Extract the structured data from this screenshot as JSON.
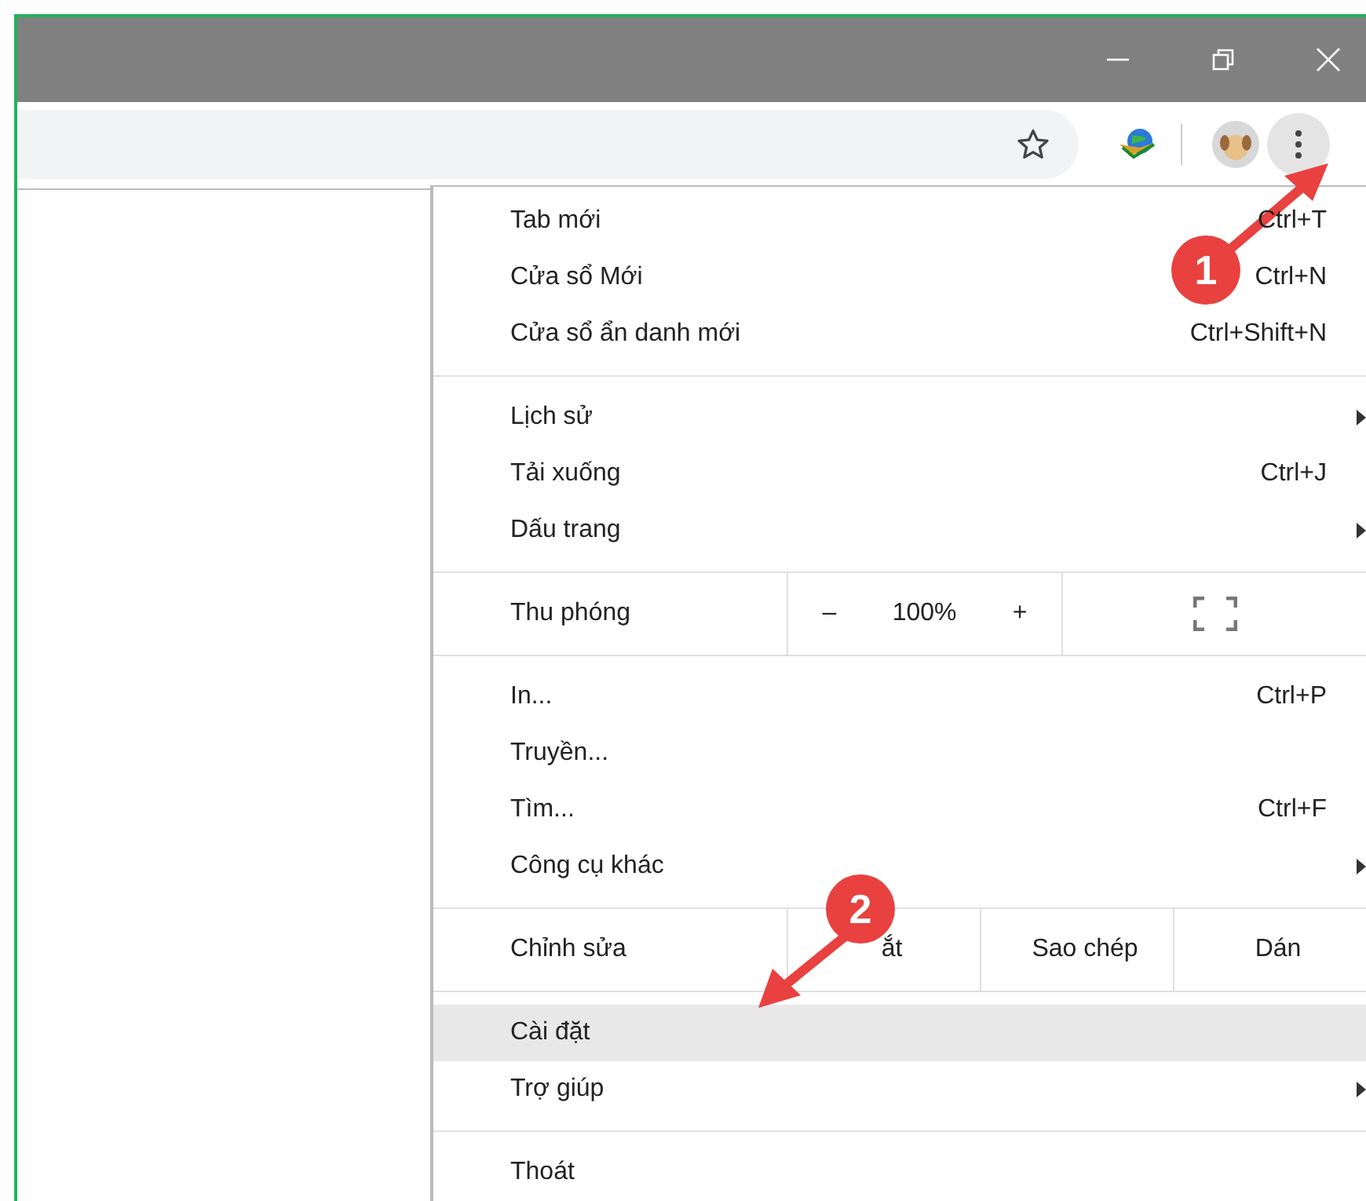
{
  "menu": {
    "sections": [
      {
        "items": [
          {
            "kind": "item",
            "label": "Tab mới",
            "shortcut": "Ctrl+T",
            "submenu": false,
            "selected": false
          },
          {
            "kind": "item",
            "label": "Cửa sổ Mới",
            "shortcut": "Ctrl+N",
            "submenu": false,
            "selected": false
          },
          {
            "kind": "item",
            "label": "Cửa sổ ẩn danh mới",
            "shortcut": "Ctrl+Shift+N",
            "submenu": false,
            "selected": false
          }
        ]
      },
      {
        "items": [
          {
            "kind": "item",
            "label": "Lịch sử",
            "submenu": true,
            "selected": false
          },
          {
            "kind": "item",
            "label": "Tải xuống",
            "shortcut": "Ctrl+J",
            "submenu": false,
            "selected": false
          },
          {
            "kind": "item",
            "label": "Dấu trang",
            "submenu": true,
            "selected": false
          }
        ]
      },
      {
        "items": [
          {
            "kind": "zoom",
            "label": "Thu phóng",
            "minus": "–",
            "value": "100%",
            "plus": "+"
          }
        ]
      },
      {
        "items": [
          {
            "kind": "item",
            "label": "In...",
            "shortcut": "Ctrl+P",
            "submenu": false,
            "selected": false
          },
          {
            "kind": "item",
            "label": "Truyền...",
            "submenu": false,
            "selected": false
          },
          {
            "kind": "item",
            "label": "Tìm...",
            "shortcut": "Ctrl+F",
            "submenu": false,
            "selected": false
          },
          {
            "kind": "item",
            "label": "Công cụ khác",
            "submenu": true,
            "selected": false
          }
        ]
      },
      {
        "items": [
          {
            "kind": "edit",
            "label": "Chỉnh sửa",
            "buttons": [
              "ắt",
              "Sao chép",
              "Dán"
            ]
          }
        ]
      },
      {
        "items": [
          {
            "kind": "item",
            "label": "Cài đặt",
            "submenu": false,
            "selected": true
          },
          {
            "kind": "item",
            "label": "Trợ giúp",
            "submenu": true,
            "selected": false
          }
        ]
      },
      {
        "items": [
          {
            "kind": "item",
            "label": "Thoát",
            "submenu": false,
            "selected": false
          }
        ]
      }
    ]
  },
  "annotations": [
    {
      "label": "1"
    },
    {
      "label": "2"
    }
  ]
}
